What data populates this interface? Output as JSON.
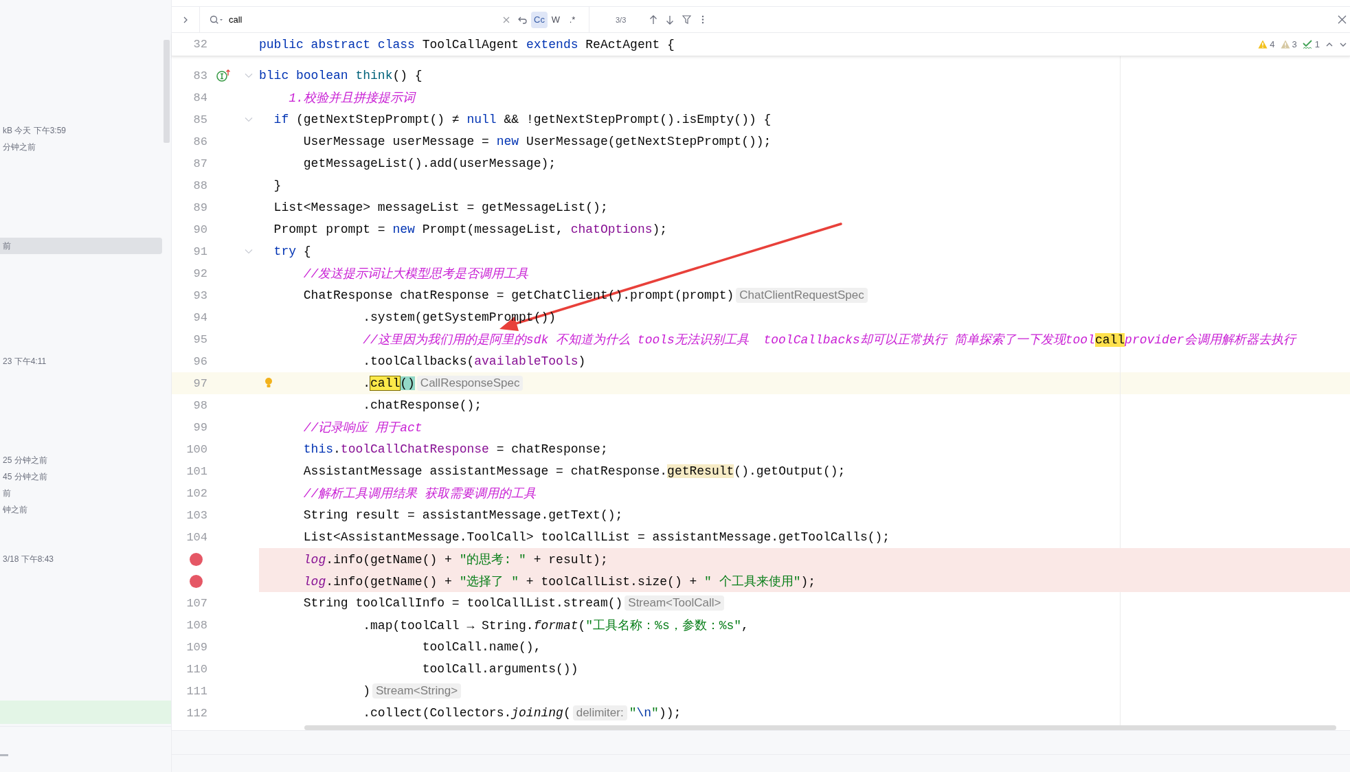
{
  "sidebar": {
    "groups": [
      [
        {
          "text": "kB 今天 下午3:59",
          "selected": false
        },
        {
          "text": "分钟之前",
          "selected": false
        }
      ],
      [
        {
          "text": "前",
          "selected": true
        }
      ],
      [
        {
          "text": "23 下午4:11",
          "selected": false
        }
      ],
      [
        {
          "text": "25 分钟之前",
          "selected": false
        },
        {
          "text": "45 分钟之前",
          "selected": false
        },
        {
          "text": "前",
          "selected": false
        },
        {
          "text": "钟之前",
          "selected": false
        }
      ],
      [
        {
          "text": "3/18 下午8:43",
          "selected": false
        }
      ]
    ]
  },
  "search": {
    "value": "call",
    "options": [
      {
        "label": "Cc",
        "selected": true
      },
      {
        "label": "W",
        "selected": false
      },
      {
        "label": ".*",
        "selected": false
      }
    ],
    "count": "3/3"
  },
  "sticky": {
    "number": "32",
    "tokens": [
      {
        "kind": "kw",
        "text": "public abstract class "
      },
      {
        "kind": "plain",
        "text": "ToolCallAgent "
      },
      {
        "kind": "kw",
        "text": "extends "
      },
      {
        "kind": "plain",
        "text": "ReActAgent {"
      }
    ]
  },
  "inspections": [
    {
      "kind": "warning",
      "count": "4"
    },
    {
      "kind": "weak",
      "count": "3"
    },
    {
      "kind": "typo",
      "count": "1"
    }
  ],
  "lines": [
    {
      "number": "83",
      "breakpoint": false,
      "current": false,
      "implements": true,
      "fold": true,
      "tokens": [
        {
          "kind": "kw",
          "text": "blic boolean "
        },
        {
          "kind": "decl",
          "text": "think"
        },
        {
          "kind": "plain",
          "text": "() {"
        }
      ]
    },
    {
      "number": "84",
      "breakpoint": false,
      "current": false,
      "tokens": [
        {
          "kind": "comment",
          "text": "    1.校验并且拼接提示词"
        }
      ]
    },
    {
      "number": "85",
      "breakpoint": false,
      "current": false,
      "fold": true,
      "tokens": [
        {
          "kind": "kw",
          "text": "  if "
        },
        {
          "kind": "plain",
          "text": "(getNextStepPrompt() ≠ "
        },
        {
          "kind": "kw",
          "text": "null "
        },
        {
          "kind": "plain",
          "text": "&& !getNextStepPrompt().isEmpty()) {"
        }
      ]
    },
    {
      "number": "86",
      "breakpoint": false,
      "current": false,
      "tokens": [
        {
          "kind": "plain",
          "text": "      UserMessage userMessage = "
        },
        {
          "kind": "kw",
          "text": "new "
        },
        {
          "kind": "plain",
          "text": "UserMessage(getNextStepPrompt());"
        }
      ]
    },
    {
      "number": "87",
      "breakpoint": false,
      "current": false,
      "tokens": [
        {
          "kind": "plain",
          "text": "      getMessageList().add(userMessage);"
        }
      ]
    },
    {
      "number": "88",
      "breakpoint": false,
      "current": false,
      "tokens": [
        {
          "kind": "plain",
          "text": "  }"
        }
      ]
    },
    {
      "number": "89",
      "breakpoint": false,
      "current": false,
      "tokens": [
        {
          "kind": "plain",
          "text": "  List<Message> messageList = getMessageList();"
        }
      ]
    },
    {
      "number": "90",
      "breakpoint": false,
      "current": false,
      "tokens": [
        {
          "kind": "plain",
          "text": "  Prompt prompt = "
        },
        {
          "kind": "kw",
          "text": "new "
        },
        {
          "kind": "plain",
          "text": "Prompt(messageList, "
        },
        {
          "kind": "field",
          "text": "chatOptions"
        },
        {
          "kind": "plain",
          "text": ");"
        }
      ]
    },
    {
      "number": "91",
      "breakpoint": false,
      "current": false,
      "fold": true,
      "tokens": [
        {
          "kind": "kw",
          "text": "  try "
        },
        {
          "kind": "plain",
          "text": "{"
        }
      ]
    },
    {
      "number": "92",
      "breakpoint": false,
      "current": false,
      "tokens": [
        {
          "kind": "comment",
          "text": "      //发送提示词让大模型思考是否调用工具"
        }
      ]
    },
    {
      "number": "93",
      "breakpoint": false,
      "current": false,
      "tokens": [
        {
          "kind": "plain",
          "text": "      ChatResponse chatResponse = getChatClient().prompt(prompt)"
        },
        {
          "kind": "hint",
          "text": "ChatClientRequestSpec"
        }
      ]
    },
    {
      "number": "94",
      "breakpoint": false,
      "current": false,
      "tokens": [
        {
          "kind": "plain",
          "text": "              .system(getSystemPrompt())"
        }
      ]
    },
    {
      "number": "95",
      "breakpoint": false,
      "current": false,
      "tokens": [
        {
          "kind": "comment",
          "text": "              //这里因为我们用的是阿里的sdk 不知道为什么 tools无法识别工具  toolCallbacks却可以正常执行 简单探索了一下发现tool"
        },
        {
          "kind": "match",
          "text": "call"
        },
        {
          "kind": "comment",
          "text": "provider会调用解析器去执行"
        }
      ]
    },
    {
      "number": "96",
      "breakpoint": false,
      "current": false,
      "tokens": [
        {
          "kind": "plain",
          "text": "              .toolCallbacks("
        },
        {
          "kind": "field",
          "text": "availableTools"
        },
        {
          "kind": "plain",
          "text": ")"
        }
      ]
    },
    {
      "number": "97",
      "breakpoint": false,
      "current": true,
      "bulb": true,
      "tokens": [
        {
          "kind": "plain",
          "text": "              ."
        },
        {
          "kind": "current-match",
          "text": "call"
        },
        {
          "kind": "brace",
          "text": "()"
        },
        {
          "kind": "hint",
          "text": "CallResponseSpec"
        }
      ]
    },
    {
      "number": "98",
      "breakpoint": false,
      "current": false,
      "tokens": [
        {
          "kind": "plain",
          "text": "              .chatResponse();"
        }
      ]
    },
    {
      "number": "99",
      "breakpoint": false,
      "current": false,
      "tokens": [
        {
          "kind": "comment",
          "text": "      //记录响应 用于act"
        }
      ]
    },
    {
      "number": "100",
      "breakpoint": false,
      "current": false,
      "tokens": [
        {
          "kind": "kw",
          "text": "      this"
        },
        {
          "kind": "plain",
          "text": "."
        },
        {
          "kind": "field",
          "text": "toolCallChatResponse"
        },
        {
          "kind": "plain",
          "text": " = chatResponse;"
        }
      ]
    },
    {
      "number": "101",
      "breakpoint": false,
      "current": false,
      "tokens": [
        {
          "kind": "plain",
          "text": "      AssistantMessage assistantMessage = chatResponse."
        },
        {
          "kind": "usage",
          "text": "getResult"
        },
        {
          "kind": "plain",
          "text": "().getOutput();"
        }
      ]
    },
    {
      "number": "102",
      "breakpoint": false,
      "current": false,
      "tokens": [
        {
          "kind": "comment",
          "text": "      //解析工具调用结果 获取需要调用的工具"
        }
      ]
    },
    {
      "number": "103",
      "breakpoint": false,
      "current": false,
      "tokens": [
        {
          "kind": "plain",
          "text": "      String result = assistantMessage.getText();"
        }
      ]
    },
    {
      "number": "104",
      "breakpoint": false,
      "current": false,
      "tokens": [
        {
          "kind": "plain",
          "text": "      List<AssistantMessage.ToolCall> toolCallList = assistantMessage.getToolCalls();"
        }
      ]
    },
    {
      "breakpoint": true,
      "current": false,
      "tokens": [
        {
          "kind": "static",
          "text": "      log"
        },
        {
          "kind": "plain",
          "text": ".info(getName() + "
        },
        {
          "kind": "string",
          "text": "\"的思考: \""
        },
        {
          "kind": "plain",
          "text": " + result);"
        }
      ]
    },
    {
      "breakpoint": true,
      "current": false,
      "tokens": [
        {
          "kind": "static",
          "text": "      log"
        },
        {
          "kind": "plain",
          "text": ".info(getName() + "
        },
        {
          "kind": "string",
          "text": "\"选择了 \""
        },
        {
          "kind": "plain",
          "text": " + toolCallList.size() + "
        },
        {
          "kind": "string",
          "text": "\" 个工具来使用\""
        },
        {
          "kind": "plain",
          "text": ");"
        }
      ]
    },
    {
      "number": "107",
      "breakpoint": false,
      "current": false,
      "tokens": [
        {
          "kind": "plain",
          "text": "      String toolCallInfo = toolCallList.stream()"
        },
        {
          "kind": "hint",
          "text": "Stream<ToolCall>"
        }
      ]
    },
    {
      "number": "108",
      "breakpoint": false,
      "current": false,
      "tokens": [
        {
          "kind": "plain",
          "text": "              .map(toolCall → String."
        },
        {
          "kind": "italic",
          "text": "format"
        },
        {
          "kind": "plain",
          "text": "("
        },
        {
          "kind": "string",
          "text": "\"工具名称：%s，参数：%s\""
        },
        {
          "kind": "plain",
          "text": ","
        }
      ]
    },
    {
      "number": "109",
      "breakpoint": false,
      "current": false,
      "tokens": [
        {
          "kind": "plain",
          "text": "                      toolCall.name(),"
        }
      ]
    },
    {
      "number": "110",
      "breakpoint": false,
      "current": false,
      "tokens": [
        {
          "kind": "plain",
          "text": "                      toolCall.arguments())"
        }
      ]
    },
    {
      "number": "111",
      "breakpoint": false,
      "current": false,
      "tokens": [
        {
          "kind": "plain",
          "text": "              )"
        },
        {
          "kind": "hint",
          "text": "Stream<String>"
        }
      ]
    },
    {
      "number": "112",
      "breakpoint": false,
      "current": false,
      "tokens": [
        {
          "kind": "plain",
          "text": "              .collect(Collectors."
        },
        {
          "kind": "italic",
          "text": "joining"
        },
        {
          "kind": "plain",
          "text": "("
        },
        {
          "kind": "hint",
          "text": "delimiter:"
        },
        {
          "kind": "string",
          "text": "\""
        },
        {
          "kind": "escape",
          "text": "\\n"
        },
        {
          "kind": "string",
          "text": "\""
        },
        {
          "kind": "plain",
          "text": "));"
        }
      ]
    }
  ]
}
